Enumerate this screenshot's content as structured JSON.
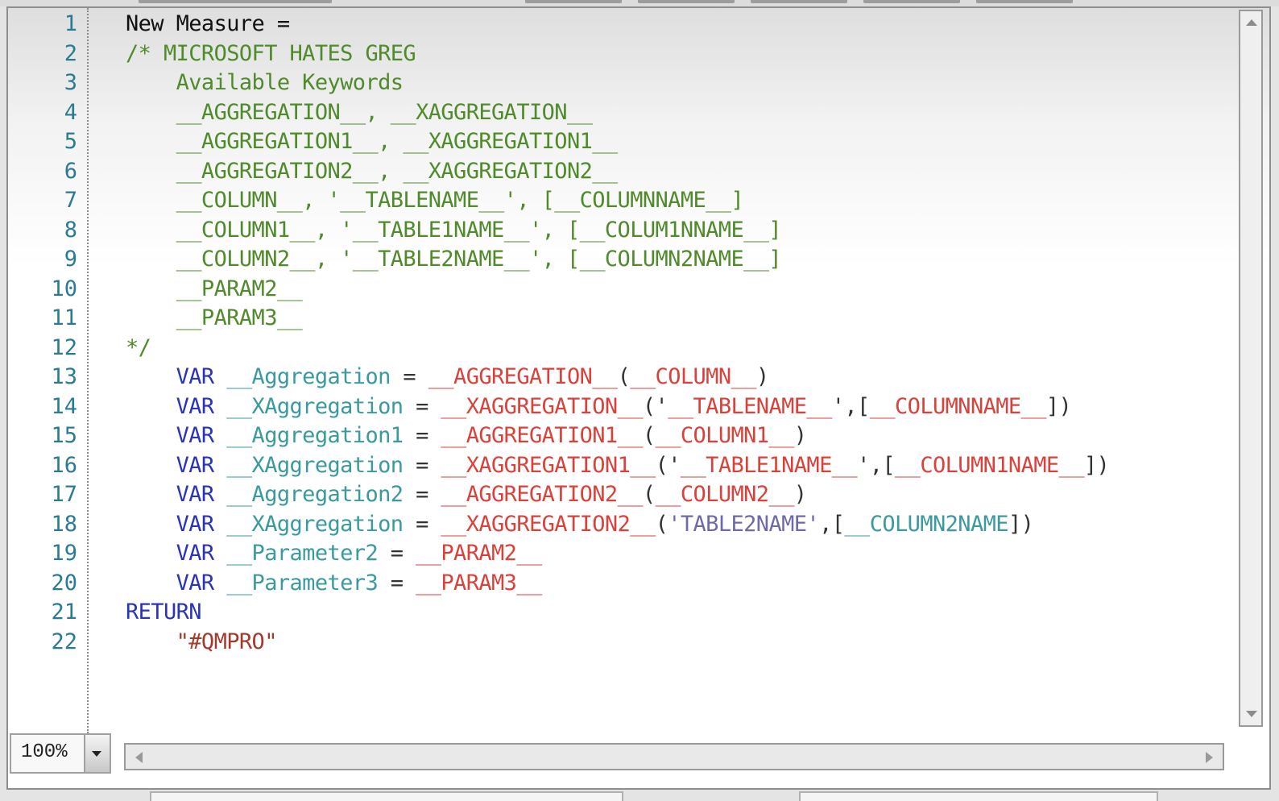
{
  "editor": {
    "zoom_level": "100%",
    "lines": [
      {
        "number": "1",
        "tokens": [
          {
            "t": "New Measure =",
            "c": "plain"
          }
        ]
      },
      {
        "number": "2",
        "tokens": [
          {
            "t": "/* MICROSOFT HATES GREG",
            "c": "comment"
          }
        ]
      },
      {
        "number": "3",
        "tokens": [
          {
            "t": "    Available Keywords",
            "c": "comment"
          }
        ]
      },
      {
        "number": "4",
        "tokens": [
          {
            "t": "    __AGGREGATION__, __XAGGREGATION__",
            "c": "comment"
          }
        ]
      },
      {
        "number": "5",
        "tokens": [
          {
            "t": "    __AGGREGATION1__, __XAGGREGATION1__",
            "c": "comment"
          }
        ]
      },
      {
        "number": "6",
        "tokens": [
          {
            "t": "    __AGGREGATION2__, __XAGGREGATION2__",
            "c": "comment"
          }
        ]
      },
      {
        "number": "7",
        "tokens": [
          {
            "t": "    __COLUMN__, '__TABLENAME__', [__COLUMNNAME__]",
            "c": "comment"
          }
        ]
      },
      {
        "number": "8",
        "tokens": [
          {
            "t": "    __COLUMN1__, '__TABLE1NAME__', [__COLUM1NNAME__]",
            "c": "comment"
          }
        ]
      },
      {
        "number": "9",
        "tokens": [
          {
            "t": "    __COLUMN2__, '__TABLE2NAME__', [__COLUMN2NAME__]",
            "c": "comment"
          }
        ]
      },
      {
        "number": "10",
        "tokens": [
          {
            "t": "    __PARAM2__",
            "c": "comment"
          }
        ]
      },
      {
        "number": "11",
        "tokens": [
          {
            "t": "    __PARAM3__",
            "c": "comment"
          }
        ]
      },
      {
        "number": "12",
        "tokens": [
          {
            "t": "*/",
            "c": "comment"
          }
        ]
      },
      {
        "number": "13",
        "tokens": [
          {
            "t": "    ",
            "c": "plain"
          },
          {
            "t": "VAR",
            "c": "keyword"
          },
          {
            "t": " ",
            "c": "plain"
          },
          {
            "t": "__Aggregation",
            "c": "variable"
          },
          {
            "t": " = ",
            "c": "op"
          },
          {
            "t": "__AGGREGATION__",
            "c": "placeholder"
          },
          {
            "t": "(",
            "c": "op"
          },
          {
            "t": "__COLUMN__",
            "c": "placeholder"
          },
          {
            "t": ")",
            "c": "op"
          }
        ]
      },
      {
        "number": "14",
        "tokens": [
          {
            "t": "    ",
            "c": "plain"
          },
          {
            "t": "VAR",
            "c": "keyword"
          },
          {
            "t": " ",
            "c": "plain"
          },
          {
            "t": "__XAggregation",
            "c": "variable"
          },
          {
            "t": " = ",
            "c": "op"
          },
          {
            "t": "__XAGGREGATION__",
            "c": "placeholder"
          },
          {
            "t": "('",
            "c": "op"
          },
          {
            "t": "__TABLENAME__",
            "c": "placeholder"
          },
          {
            "t": "',[",
            "c": "op"
          },
          {
            "t": "__COLUMNNAME__",
            "c": "placeholder"
          },
          {
            "t": "])",
            "c": "op"
          }
        ]
      },
      {
        "number": "15",
        "tokens": [
          {
            "t": "    ",
            "c": "plain"
          },
          {
            "t": "VAR",
            "c": "keyword"
          },
          {
            "t": " ",
            "c": "plain"
          },
          {
            "t": "__Aggregation1",
            "c": "variable"
          },
          {
            "t": " = ",
            "c": "op"
          },
          {
            "t": "__AGGREGATION1__",
            "c": "placeholder"
          },
          {
            "t": "(",
            "c": "op"
          },
          {
            "t": "__COLUMN1__",
            "c": "placeholder"
          },
          {
            "t": ")",
            "c": "op"
          }
        ]
      },
      {
        "number": "16",
        "tokens": [
          {
            "t": "    ",
            "c": "plain"
          },
          {
            "t": "VAR",
            "c": "keyword"
          },
          {
            "t": " ",
            "c": "plain"
          },
          {
            "t": "__XAggregation",
            "c": "variable"
          },
          {
            "t": " = ",
            "c": "op"
          },
          {
            "t": "__XAGGREGATION1__",
            "c": "placeholder"
          },
          {
            "t": "('",
            "c": "op"
          },
          {
            "t": "__TABLE1NAME__",
            "c": "placeholder"
          },
          {
            "t": "',[",
            "c": "op"
          },
          {
            "t": "__COLUMN1NAME__",
            "c": "placeholder"
          },
          {
            "t": "])",
            "c": "op"
          }
        ]
      },
      {
        "number": "17",
        "tokens": [
          {
            "t": "    ",
            "c": "plain"
          },
          {
            "t": "VAR",
            "c": "keyword"
          },
          {
            "t": " ",
            "c": "plain"
          },
          {
            "t": "__Aggregation2",
            "c": "variable"
          },
          {
            "t": " = ",
            "c": "op"
          },
          {
            "t": "__AGGREGATION2__",
            "c": "placeholder"
          },
          {
            "t": "(",
            "c": "op"
          },
          {
            "t": "__COLUMN2__",
            "c": "placeholder"
          },
          {
            "t": ")",
            "c": "op"
          }
        ]
      },
      {
        "number": "18",
        "tokens": [
          {
            "t": "    ",
            "c": "plain"
          },
          {
            "t": "VAR",
            "c": "keyword"
          },
          {
            "t": " ",
            "c": "plain"
          },
          {
            "t": "__XAggregation",
            "c": "variable"
          },
          {
            "t": " = ",
            "c": "op"
          },
          {
            "t": "__XAGGREGATION2__",
            "c": "placeholder"
          },
          {
            "t": "(",
            "c": "op"
          },
          {
            "t": "'TABLE2NAME'",
            "c": "string"
          },
          {
            "t": ",[",
            "c": "op"
          },
          {
            "t": "__COLUMN2NAME",
            "c": "variable"
          },
          {
            "t": "])",
            "c": "op"
          }
        ]
      },
      {
        "number": "19",
        "tokens": [
          {
            "t": "    ",
            "c": "plain"
          },
          {
            "t": "VAR",
            "c": "keyword"
          },
          {
            "t": " ",
            "c": "plain"
          },
          {
            "t": "__Parameter2",
            "c": "variable"
          },
          {
            "t": " = ",
            "c": "op"
          },
          {
            "t": "__PARAM2__",
            "c": "placeholder"
          }
        ]
      },
      {
        "number": "20",
        "tokens": [
          {
            "t": "    ",
            "c": "plain"
          },
          {
            "t": "VAR",
            "c": "keyword"
          },
          {
            "t": " ",
            "c": "plain"
          },
          {
            "t": "__Parameter3",
            "c": "variable"
          },
          {
            "t": " = ",
            "c": "op"
          },
          {
            "t": "__PARAM3__",
            "c": "placeholder"
          }
        ]
      },
      {
        "number": "21",
        "tokens": [
          {
            "t": "RETURN",
            "c": "keyword"
          }
        ]
      },
      {
        "number": "22",
        "tokens": [
          {
            "t": "    ",
            "c": "plain"
          },
          {
            "t": "\"#QMPRO\"",
            "c": "retstring"
          }
        ]
      }
    ]
  },
  "icons": {
    "scroll_up": "triangle-up",
    "scroll_down": "triangle-down",
    "scroll_left": "triangle-left",
    "scroll_right": "triangle-right",
    "zoom_dropdown": "triangle-down"
  },
  "colors": {
    "line_number": "#2b7a93",
    "comment": "#4f8a2b",
    "keyword": "#2a34b8",
    "variable": "#3a9a9e",
    "placeholder": "#d9423a",
    "string": "#6e6aa8",
    "return_string": "#a33a2e"
  }
}
